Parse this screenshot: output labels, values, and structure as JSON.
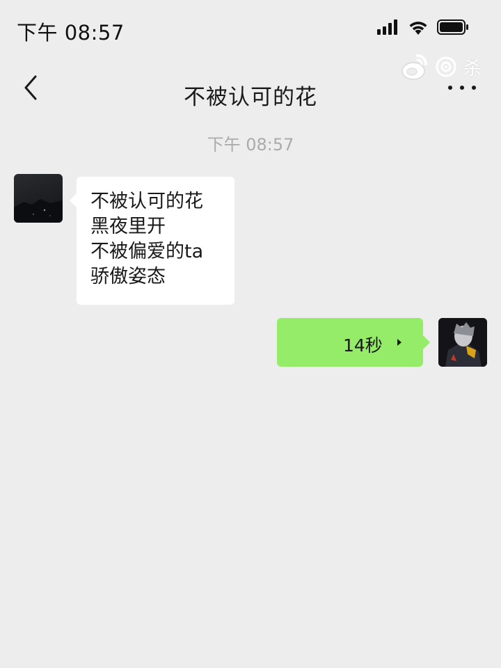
{
  "status_bar": {
    "time": "下午 08:57",
    "icons": [
      "signal-icon",
      "wifi-icon",
      "battery-icon"
    ]
  },
  "watermark": {
    "icons": [
      "weibo-logo-icon",
      "weibo-camera-icon"
    ],
    "text": "杀"
  },
  "nav": {
    "back_icon": "chevron-left-icon",
    "title": "不被认可的花",
    "more_icon": "more-dots-icon"
  },
  "chat": {
    "timestamp": "下午 08:57",
    "messages": [
      {
        "side": "left",
        "type": "text",
        "lines": [
          "不被认可的花",
          "黑夜里开",
          "不被偏爱的ta",
          "骄傲姿态"
        ]
      },
      {
        "side": "right",
        "type": "voice",
        "duration": "14秒"
      }
    ]
  },
  "colors": {
    "background": "#ededed",
    "incoming_bubble": "#ffffff",
    "outgoing_bubble": "#95ec69",
    "timestamp_text": "#ababab"
  }
}
